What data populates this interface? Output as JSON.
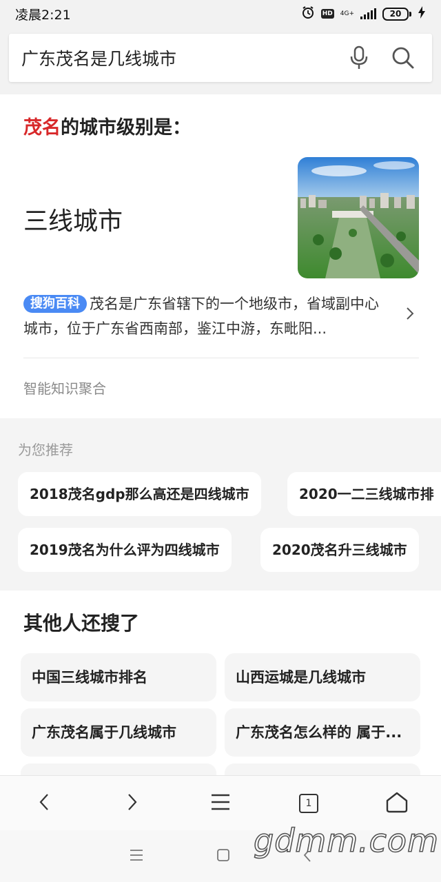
{
  "status": {
    "time": "凌晨2:21",
    "hd": "HD",
    "network": "4G+",
    "battery": "20"
  },
  "search": {
    "query": "广东茂名是几线城市",
    "icons": [
      "mic-icon",
      "search-icon"
    ]
  },
  "answer": {
    "title_highlight": "茂名",
    "title_rest": "的城市级别是：",
    "value": "三线城市",
    "source_badge": "搜狗百科",
    "description": "茂名是广东省辖下的一个地级市，省域副中心城市，位于广东省西南部，鉴江中游，东毗阳...",
    "footer": "智能知识聚合"
  },
  "recommend": {
    "title": "为您推荐",
    "items": [
      "2018茂名gdp那么高还是四线城市",
      "2020一二三线城市排",
      "2019茂名为什么评为四线城市",
      "2020茂名升三线城市"
    ]
  },
  "others": {
    "title": "其他人还搜了",
    "items": [
      "中国三线城市排名",
      "山西运城是几线城市",
      "广东茂名属于几线城市",
      "广东茂名怎么样的 属于..."
    ]
  },
  "toolbar": {
    "tab_count": "1",
    "icons": [
      "back-icon",
      "forward-icon",
      "menu-icon",
      "tabs-icon",
      "home-icon"
    ]
  },
  "watermark": "gdmm.com",
  "colors": {
    "highlight": "#d8282a",
    "badge": "#4a8af4"
  }
}
